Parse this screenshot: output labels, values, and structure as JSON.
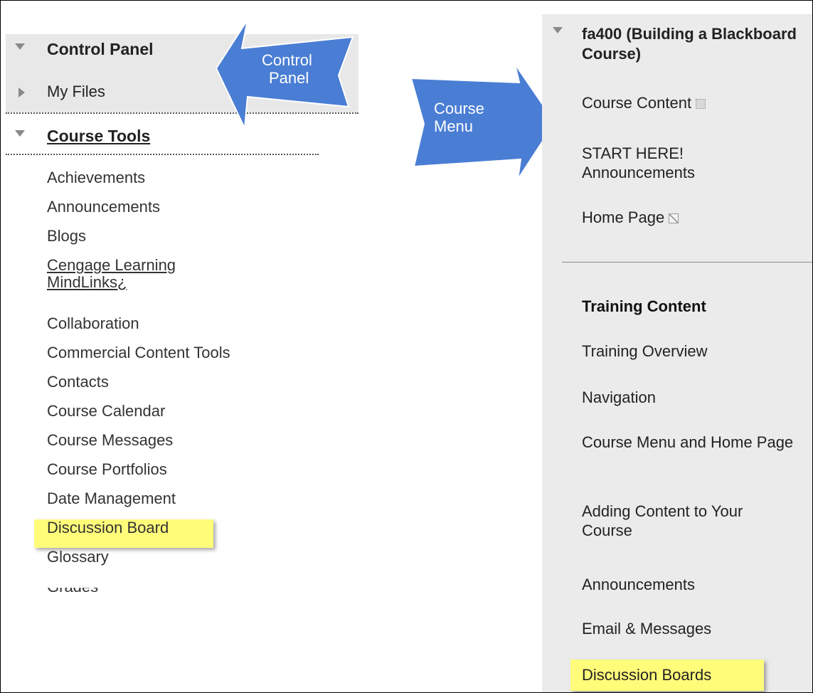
{
  "control_panel": {
    "title": "Control Panel",
    "my_files": "My Files"
  },
  "course_tools": {
    "title": "Course Tools",
    "items": [
      "Achievements",
      "Announcements",
      "Blogs",
      "Cengage Learning MindLinks¿",
      "Collaboration",
      "Commercial Content Tools",
      "Contacts",
      "Course Calendar",
      "Course Messages",
      "Course Portfolios",
      "Date Management",
      "Discussion Board",
      "Glossary",
      "Grades"
    ],
    "highlighted": "Discussion Board"
  },
  "callouts": {
    "control_panel_line1": "Control",
    "control_panel_line2": "Panel",
    "course_menu_line1": "Course",
    "course_menu_line2": "Menu",
    "arrow_color": "#4a7ed4"
  },
  "course_menu": {
    "title": "fa400 (Building a Blackboard Course)",
    "items": {
      "course_content": "Course Content",
      "start_here": "START HERE! Announcements",
      "home_page": "Home Page"
    },
    "section_heading": "Training Content",
    "training_items": [
      "Training Overview",
      "Navigation",
      "Course Menu and Home Page",
      "Adding Content to Your Course",
      "Announcements",
      "Email & Messages",
      "Discussion Boards"
    ]
  },
  "colors": {
    "highlight": "#fffc7a",
    "panel_bg": "#ebebeb"
  }
}
